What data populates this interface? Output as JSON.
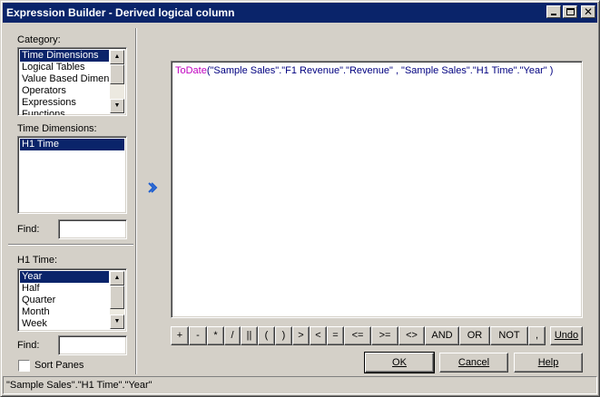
{
  "window": {
    "title": "Expression Builder - Derived logical column"
  },
  "category": {
    "label": "Category:",
    "items": [
      "Time Dimensions",
      "Logical Tables",
      "Value Based Dimensi",
      "Operators",
      "Expressions",
      "Functions"
    ]
  },
  "time_dimensions": {
    "label": "Time Dimensions:",
    "items": [
      "H1 Time"
    ]
  },
  "find_top": {
    "label": "Find:",
    "value": ""
  },
  "h1_time": {
    "label": "H1 Time:",
    "items": [
      "Year",
      "Half",
      "Quarter",
      "Month",
      "Week"
    ]
  },
  "find_bottom": {
    "label": "Find:",
    "value": ""
  },
  "sort_panes": {
    "label": "Sort Panes",
    "checked": false
  },
  "expression": {
    "function": "ToDate",
    "arguments": "(\"Sample Sales\".\"F1 Revenue\".\"Revenue\" ,  \"Sample Sales\".\"H1 Time\".\"Year\" )"
  },
  "operators": [
    "+",
    "-",
    "*",
    "/",
    "||",
    "(",
    ")",
    ">",
    "<",
    "=",
    "<=",
    ">=",
    "<>",
    "AND",
    "OR",
    "NOT",
    ","
  ],
  "buttons": {
    "undo": "Undo",
    "ok": "OK",
    "cancel": "Cancel",
    "help": "Help"
  },
  "status": {
    "text": "\"Sample Sales\".\"H1 Time\".\"Year\""
  }
}
